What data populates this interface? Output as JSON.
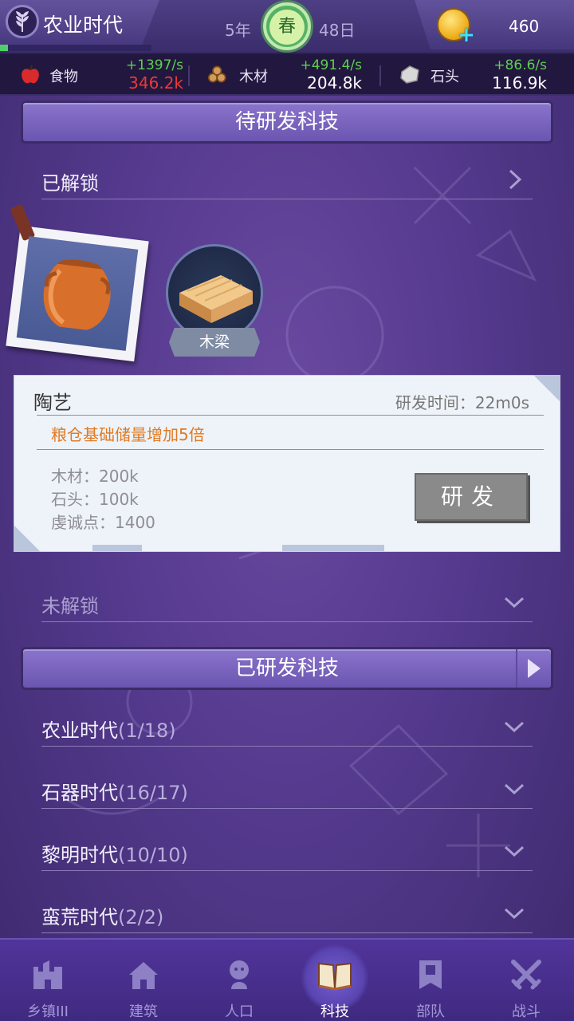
{
  "topbar": {
    "era_name": "农业时代",
    "year": "5年",
    "season": "春",
    "day": "48日",
    "coins": "460",
    "era_progress": 0.05
  },
  "resources": [
    {
      "name": "食物",
      "rate": "+1397/s",
      "amount": "346.2k",
      "amount_color": "#e83a3a",
      "icon": "apple-icon"
    },
    {
      "name": "木材",
      "rate": "+491.4/s",
      "amount": "204.8k",
      "amount_color": "#ffffff",
      "icon": "wood-logs-icon"
    },
    {
      "name": "石头",
      "rate": "+86.6/s",
      "amount": "116.9k",
      "amount_color": "#ffffff",
      "icon": "stone-icon"
    }
  ],
  "pending": {
    "header": "待研发科技",
    "unlocked_label": "已解锁",
    "selected_tech": {
      "name": "陶艺",
      "time": "研发时间：22m0s",
      "effect": "粮仓基础储量增加5倍",
      "costs": [
        "木材：200k",
        "石头：100k",
        "虔诚点：1400"
      ],
      "button": "研发"
    },
    "other_tech_label": "木梁",
    "locked_label": "未解锁"
  },
  "researched": {
    "header": "已研发科技",
    "eras": [
      {
        "name": "农业时代",
        "count": "(1/18)"
      },
      {
        "name": "石器时代",
        "count": "(16/17)"
      },
      {
        "name": "黎明时代",
        "count": "(10/10)"
      },
      {
        "name": "蛮荒时代",
        "count": "(2/2)"
      }
    ]
  },
  "nav": [
    {
      "label": "乡镇III",
      "icon": "castle-icon"
    },
    {
      "label": "建筑",
      "icon": "house-icon"
    },
    {
      "label": "人口",
      "icon": "person-icon"
    },
    {
      "label": "科技",
      "icon": "book-icon",
      "active": true
    },
    {
      "label": "部队",
      "icon": "banner-icon"
    },
    {
      "label": "战斗",
      "icon": "crossed-swords-icon"
    }
  ],
  "colors": {
    "accent_green": "#5cd04e",
    "effect_orange": "#e07a22",
    "background_purple": "#553a8e"
  }
}
